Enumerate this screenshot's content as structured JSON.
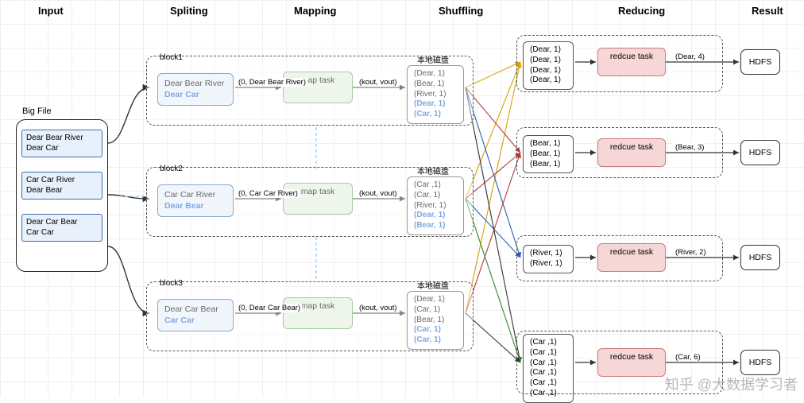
{
  "stages": {
    "input": "Input",
    "splitting": "Spliting",
    "mapping": "Mapping",
    "shuffling": "Shuffling",
    "reducing": "Reducing",
    "result": "Result"
  },
  "bigfile_label": "Big File",
  "file_slices": [
    "Dear Bear River\nDear Car",
    "Car Car River\nDear Bear",
    "Dear Car Bear\nCar Car"
  ],
  "block_label": "本地磁盘",
  "blocks": [
    {
      "name": "block1",
      "split_main": "Dear Bear River",
      "split_hl": "Dear Car",
      "map_in": "(0, Dear Bear River)",
      "map_label": "map task",
      "map_out": "(kout, vout)",
      "kv": [
        "(Dear, 1)",
        "(Bear, 1)",
        "(River, 1)"
      ],
      "kv_hl": [
        "(Dear, 1)",
        "(Car, 1)"
      ]
    },
    {
      "name": "block2",
      "split_main": "Car Car River",
      "split_hl": "Dear Bear",
      "map_in": "(0, Car Car River)",
      "map_label": "map task",
      "map_out": "(kout, vout)",
      "kv": [
        "(Car ,1)",
        "(Car, 1)",
        "(River, 1)"
      ],
      "kv_hl": [
        "(Dear, 1)",
        "(Bear, 1)"
      ]
    },
    {
      "name": "block3",
      "split_main": "Dear Car Bear",
      "split_hl": "Car Car",
      "map_in": "(0, Dear Car Bear)",
      "map_label": "map task",
      "map_out": "(kout, vout)",
      "kv": [
        "(Dear, 1)",
        "(Car, 1)",
        "(Bear, 1)"
      ],
      "kv_hl": [
        "(Car, 1)",
        "(Car, 1)"
      ]
    }
  ],
  "reduces": [
    {
      "kv": [
        "(Dear, 1)",
        "(Dear, 1)",
        "(Dear, 1)",
        "(Dear, 1)"
      ],
      "label": "redcue task",
      "out": "(Dear, 4)",
      "hdfs": "HDFS"
    },
    {
      "kv": [
        "(Bear, 1)",
        "(Bear, 1)",
        "(Bear, 1)"
      ],
      "label": "redcue task",
      "out": "(Bear, 3)",
      "hdfs": "HDFS"
    },
    {
      "kv": [
        "(River, 1)",
        "(River, 1)"
      ],
      "label": "redcue task",
      "out": "(River, 2)",
      "hdfs": "HDFS"
    },
    {
      "kv": [
        "(Car ,1)",
        "(Car ,1)",
        "(Car ,1)",
        "(Car ,1)",
        "(Car ,1)",
        "(Car ,1)"
      ],
      "label": "redcue task",
      "out": "(Car, 6)",
      "hdfs": "HDFS"
    }
  ],
  "watermark": "知乎 @大数据学习者"
}
